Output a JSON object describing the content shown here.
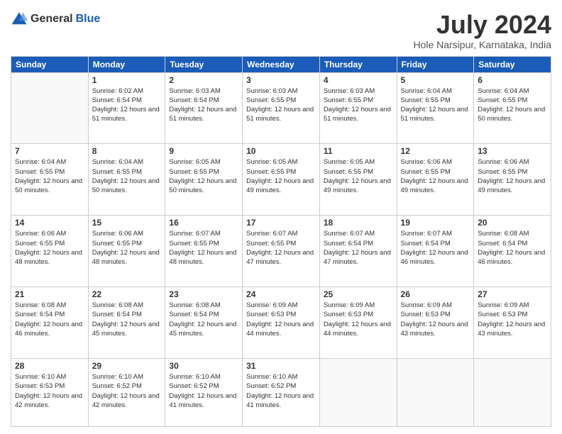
{
  "logo": {
    "general": "General",
    "blue": "Blue"
  },
  "header": {
    "month": "July 2024",
    "location": "Hole Narsipur, Karnataka, India"
  },
  "days": [
    "Sunday",
    "Monday",
    "Tuesday",
    "Wednesday",
    "Thursday",
    "Friday",
    "Saturday"
  ],
  "weeks": [
    [
      {
        "num": "",
        "sunrise": "",
        "sunset": "",
        "daylight": ""
      },
      {
        "num": "1",
        "sunrise": "Sunrise: 6:02 AM",
        "sunset": "Sunset: 6:54 PM",
        "daylight": "Daylight: 12 hours and 51 minutes."
      },
      {
        "num": "2",
        "sunrise": "Sunrise: 6:03 AM",
        "sunset": "Sunset: 6:54 PM",
        "daylight": "Daylight: 12 hours and 51 minutes."
      },
      {
        "num": "3",
        "sunrise": "Sunrise: 6:03 AM",
        "sunset": "Sunset: 6:55 PM",
        "daylight": "Daylight: 12 hours and 51 minutes."
      },
      {
        "num": "4",
        "sunrise": "Sunrise: 6:03 AM",
        "sunset": "Sunset: 6:55 PM",
        "daylight": "Daylight: 12 hours and 51 minutes."
      },
      {
        "num": "5",
        "sunrise": "Sunrise: 6:04 AM",
        "sunset": "Sunset: 6:55 PM",
        "daylight": "Daylight: 12 hours and 51 minutes."
      },
      {
        "num": "6",
        "sunrise": "Sunrise: 6:04 AM",
        "sunset": "Sunset: 6:55 PM",
        "daylight": "Daylight: 12 hours and 50 minutes."
      }
    ],
    [
      {
        "num": "7",
        "sunrise": "Sunrise: 6:04 AM",
        "sunset": "Sunset: 6:55 PM",
        "daylight": "Daylight: 12 hours and 50 minutes."
      },
      {
        "num": "8",
        "sunrise": "Sunrise: 6:04 AM",
        "sunset": "Sunset: 6:55 PM",
        "daylight": "Daylight: 12 hours and 50 minutes."
      },
      {
        "num": "9",
        "sunrise": "Sunrise: 6:05 AM",
        "sunset": "Sunset: 6:55 PM",
        "daylight": "Daylight: 12 hours and 50 minutes."
      },
      {
        "num": "10",
        "sunrise": "Sunrise: 6:05 AM",
        "sunset": "Sunset: 6:55 PM",
        "daylight": "Daylight: 12 hours and 49 minutes."
      },
      {
        "num": "11",
        "sunrise": "Sunrise: 6:05 AM",
        "sunset": "Sunset: 6:55 PM",
        "daylight": "Daylight: 12 hours and 49 minutes."
      },
      {
        "num": "12",
        "sunrise": "Sunrise: 6:06 AM",
        "sunset": "Sunset: 6:55 PM",
        "daylight": "Daylight: 12 hours and 49 minutes."
      },
      {
        "num": "13",
        "sunrise": "Sunrise: 6:06 AM",
        "sunset": "Sunset: 6:55 PM",
        "daylight": "Daylight: 12 hours and 49 minutes."
      }
    ],
    [
      {
        "num": "14",
        "sunrise": "Sunrise: 6:06 AM",
        "sunset": "Sunset: 6:55 PM",
        "daylight": "Daylight: 12 hours and 48 minutes."
      },
      {
        "num": "15",
        "sunrise": "Sunrise: 6:06 AM",
        "sunset": "Sunset: 6:55 PM",
        "daylight": "Daylight: 12 hours and 48 minutes."
      },
      {
        "num": "16",
        "sunrise": "Sunrise: 6:07 AM",
        "sunset": "Sunset: 6:55 PM",
        "daylight": "Daylight: 12 hours and 48 minutes."
      },
      {
        "num": "17",
        "sunrise": "Sunrise: 6:07 AM",
        "sunset": "Sunset: 6:55 PM",
        "daylight": "Daylight: 12 hours and 47 minutes."
      },
      {
        "num": "18",
        "sunrise": "Sunrise: 6:07 AM",
        "sunset": "Sunset: 6:54 PM",
        "daylight": "Daylight: 12 hours and 47 minutes."
      },
      {
        "num": "19",
        "sunrise": "Sunrise: 6:07 AM",
        "sunset": "Sunset: 6:54 PM",
        "daylight": "Daylight: 12 hours and 46 minutes."
      },
      {
        "num": "20",
        "sunrise": "Sunrise: 6:08 AM",
        "sunset": "Sunset: 6:54 PM",
        "daylight": "Daylight: 12 hours and 46 minutes."
      }
    ],
    [
      {
        "num": "21",
        "sunrise": "Sunrise: 6:08 AM",
        "sunset": "Sunset: 6:54 PM",
        "daylight": "Daylight: 12 hours and 46 minutes."
      },
      {
        "num": "22",
        "sunrise": "Sunrise: 6:08 AM",
        "sunset": "Sunset: 6:54 PM",
        "daylight": "Daylight: 12 hours and 45 minutes."
      },
      {
        "num": "23",
        "sunrise": "Sunrise: 6:08 AM",
        "sunset": "Sunset: 6:54 PM",
        "daylight": "Daylight: 12 hours and 45 minutes."
      },
      {
        "num": "24",
        "sunrise": "Sunrise: 6:09 AM",
        "sunset": "Sunset: 6:53 PM",
        "daylight": "Daylight: 12 hours and 44 minutes."
      },
      {
        "num": "25",
        "sunrise": "Sunrise: 6:09 AM",
        "sunset": "Sunset: 6:53 PM",
        "daylight": "Daylight: 12 hours and 44 minutes."
      },
      {
        "num": "26",
        "sunrise": "Sunrise: 6:09 AM",
        "sunset": "Sunset: 6:53 PM",
        "daylight": "Daylight: 12 hours and 43 minutes."
      },
      {
        "num": "27",
        "sunrise": "Sunrise: 6:09 AM",
        "sunset": "Sunset: 6:53 PM",
        "daylight": "Daylight: 12 hours and 43 minutes."
      }
    ],
    [
      {
        "num": "28",
        "sunrise": "Sunrise: 6:10 AM",
        "sunset": "Sunset: 6:53 PM",
        "daylight": "Daylight: 12 hours and 42 minutes."
      },
      {
        "num": "29",
        "sunrise": "Sunrise: 6:10 AM",
        "sunset": "Sunset: 6:52 PM",
        "daylight": "Daylight: 12 hours and 42 minutes."
      },
      {
        "num": "30",
        "sunrise": "Sunrise: 6:10 AM",
        "sunset": "Sunset: 6:52 PM",
        "daylight": "Daylight: 12 hours and 41 minutes."
      },
      {
        "num": "31",
        "sunrise": "Sunrise: 6:10 AM",
        "sunset": "Sunset: 6:52 PM",
        "daylight": "Daylight: 12 hours and 41 minutes."
      },
      {
        "num": "",
        "sunrise": "",
        "sunset": "",
        "daylight": ""
      },
      {
        "num": "",
        "sunrise": "",
        "sunset": "",
        "daylight": ""
      },
      {
        "num": "",
        "sunrise": "",
        "sunset": "",
        "daylight": ""
      }
    ]
  ]
}
